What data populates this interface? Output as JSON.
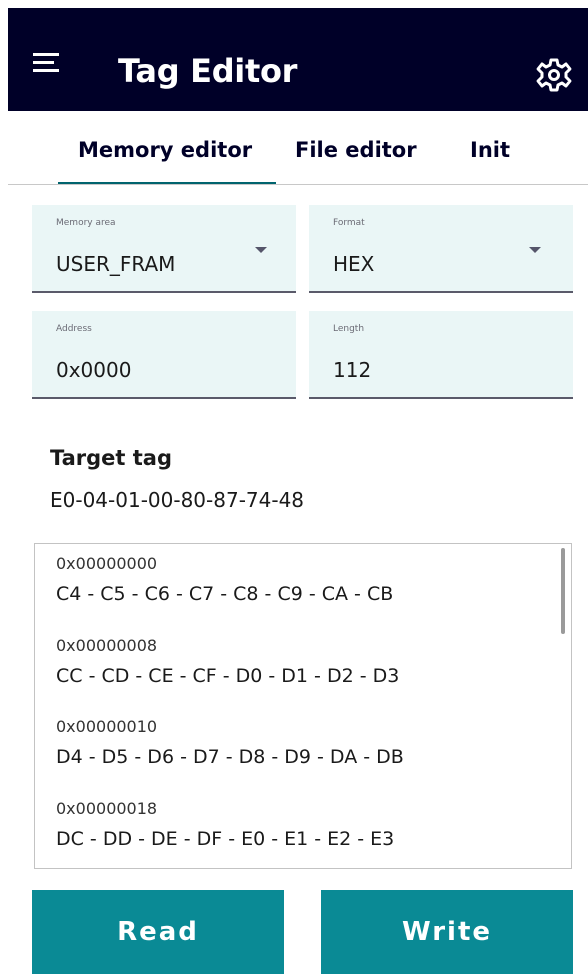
{
  "app": {
    "title": "Tag Editor",
    "menu_icon": "hamburger-menu-icon",
    "settings_icon": "gear-icon"
  },
  "tabs": [
    {
      "label": "Memory editor",
      "selected": true
    },
    {
      "label": "File editor",
      "selected": false
    },
    {
      "label": "Init",
      "selected": false
    }
  ],
  "fields": {
    "memory_area": {
      "label": "Memory area",
      "value": "USER_FRAM"
    },
    "format": {
      "label": "Format",
      "value": "HEX"
    },
    "address": {
      "label": "Address",
      "value": "0x0000"
    },
    "length": {
      "label": "Length",
      "value": "112"
    }
  },
  "target": {
    "title": "Target tag",
    "value": "E0-04-01-00-80-87-74-48"
  },
  "memory_rows": [
    {
      "address": "0x00000000",
      "bytes": "C4 - C5 - C6 - C7 - C8 - C9 - CA - CB"
    },
    {
      "address": "0x00000008",
      "bytes": "CC - CD - CE - CF - D0 - D1 - D2 - D3"
    },
    {
      "address": "0x00000010",
      "bytes": "D4 - D5 - D6 - D7 - D8 - D9 - DA - DB"
    },
    {
      "address": "0x00000018",
      "bytes": "DC - DD - DE - DF - E0 - E1 - E2 - E3"
    }
  ],
  "buttons": {
    "read": "Read",
    "write": "Write"
  },
  "colors": {
    "app_bar": "#000028",
    "accent": "#00646e",
    "button": "#0a8a95",
    "field_background": "#eaf6f6"
  }
}
